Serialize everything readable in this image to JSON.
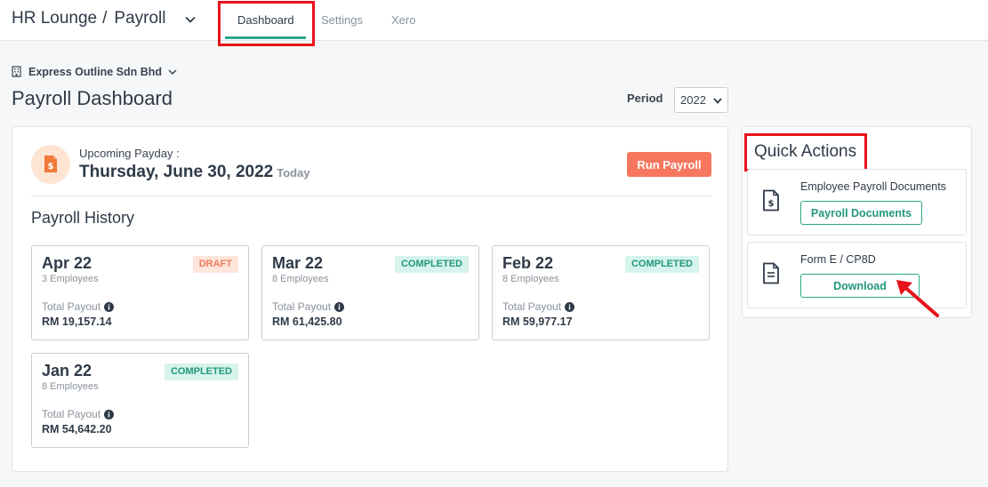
{
  "header": {
    "app_name": "HR Lounge",
    "separator": "/",
    "module": "Payroll",
    "tabs": [
      {
        "label": "Dashboard",
        "active": true
      },
      {
        "label": "Settings",
        "active": false
      },
      {
        "label": "Xero",
        "active": false
      }
    ]
  },
  "company": {
    "name": "Express Outline Sdn Bhd"
  },
  "page": {
    "title": "Payroll Dashboard"
  },
  "period": {
    "label": "Period",
    "selected": "2022"
  },
  "payday": {
    "label": "Upcoming Payday :",
    "date": "Thursday, June 30, 2022",
    "relative": "Today",
    "run_button": "Run Payroll"
  },
  "history": {
    "title": "Payroll History",
    "total_label": "Total Payout",
    "items": [
      {
        "month": "Apr 22",
        "employees": "3 Employees",
        "status": "DRAFT",
        "amount": "RM 19,157.14"
      },
      {
        "month": "Mar 22",
        "employees": "8 Employees",
        "status": "COMPLETED",
        "amount": "RM 61,425.80"
      },
      {
        "month": "Feb 22",
        "employees": "8 Employees",
        "status": "COMPLETED",
        "amount": "RM 59,977.17"
      },
      {
        "month": "Jan 22",
        "employees": "8 Employees",
        "status": "COMPLETED",
        "amount": "RM 54,642.20"
      }
    ]
  },
  "quick_actions": {
    "title": "Quick Actions",
    "items": [
      {
        "label": "Employee Payroll Documents",
        "button": "Payroll Documents",
        "icon": "invoice-dollar-icon"
      },
      {
        "label": "Form E / CP8D",
        "button": "Download",
        "icon": "document-icon"
      }
    ]
  },
  "colors": {
    "accent": "#2aa88a",
    "run_payroll": "#f7775e",
    "highlight": "#e8121b"
  }
}
